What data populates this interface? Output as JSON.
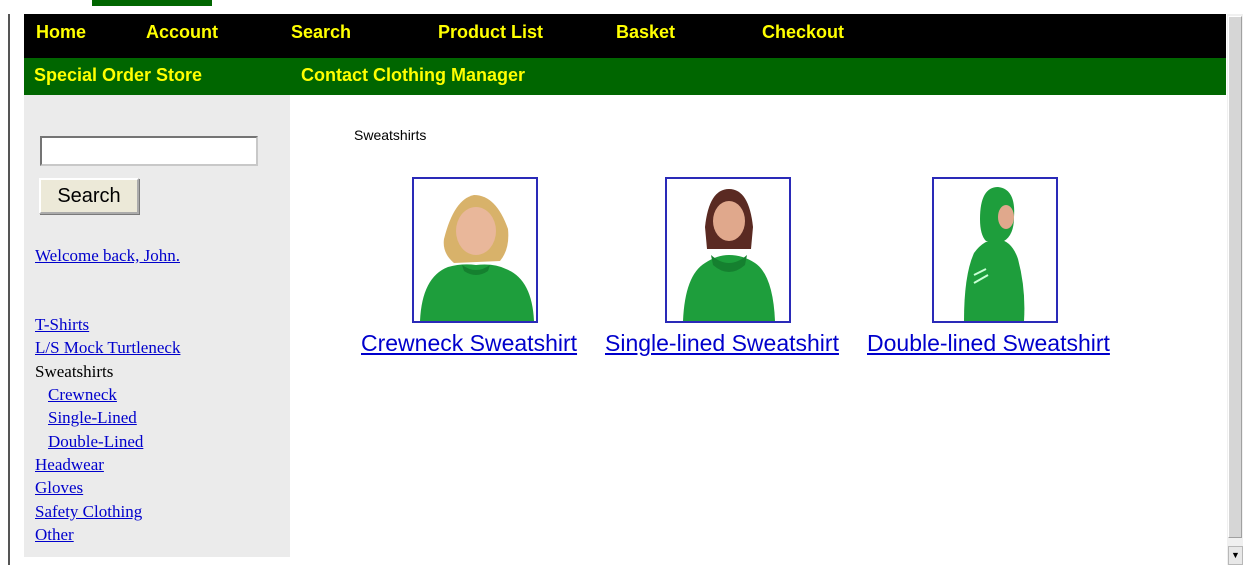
{
  "nav": {
    "primary": [
      "Home",
      "Account",
      "Search",
      "Product List",
      "Basket",
      "Checkout"
    ],
    "secondary": [
      "Special Order Store",
      "Contact Clothing Manager"
    ]
  },
  "sidebar": {
    "search_value": "",
    "search_button": "Search",
    "welcome": "Welcome back, John.",
    "categories": {
      "tshirts": "T-Shirts",
      "mock_turtleneck": "L/S Mock Turtleneck",
      "sweatshirts": "Sweatshirts",
      "crewneck": "Crewneck",
      "single_lined": "Single-Lined",
      "double_lined": "Double-Lined",
      "headwear": "Headwear",
      "gloves": "Gloves",
      "safety": "Safety Clothing",
      "other": "Other"
    }
  },
  "main": {
    "title": "Sweatshirts",
    "products": [
      {
        "name": "Crewneck Sweatshirt"
      },
      {
        "name": "Single-lined Sweatshirt"
      },
      {
        "name": "Double-lined Sweatshirt"
      }
    ]
  },
  "colors": {
    "nav_primary_bg": "#000000",
    "nav_secondary_bg": "#006600",
    "nav_text": "#ffff00",
    "sidebar_bg": "#ebebeb",
    "link": "#0000cc",
    "product_border": "#2a2ab8",
    "sweatshirt_green": "#1e9e3c"
  }
}
